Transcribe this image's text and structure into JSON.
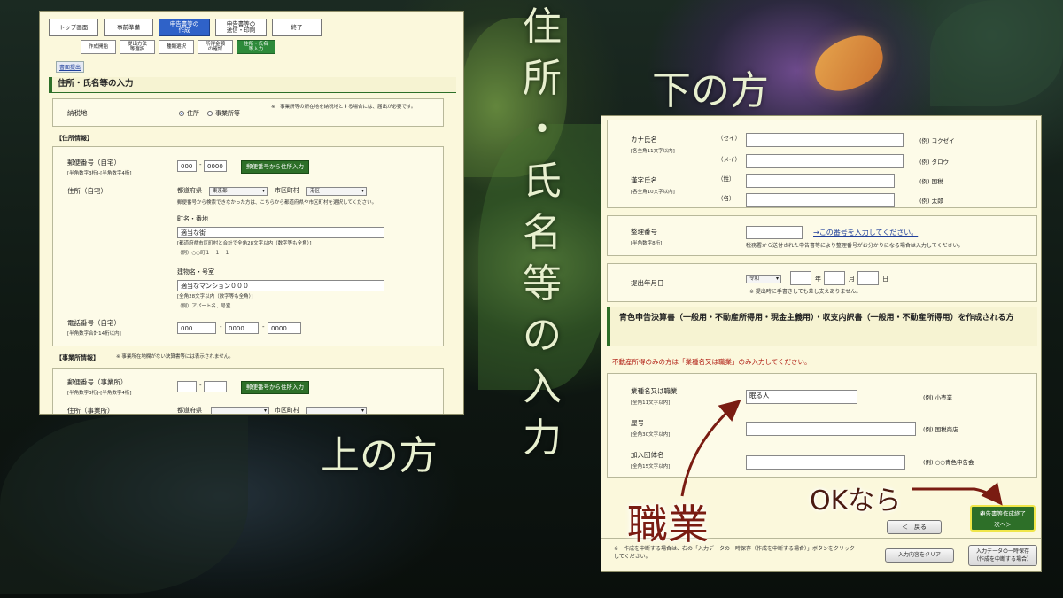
{
  "overlay": {
    "vertical_title": [
      "住",
      "所",
      "・",
      "氏",
      "名",
      "等",
      "の",
      "入",
      "力"
    ],
    "label_bottom": "下の方",
    "label_top": "上の方",
    "label_job": "職業",
    "label_ok": "OKなら",
    "colors": {
      "overlay_text": "#e8f0cf",
      "arrow": "#7a1c12",
      "panel_bg": "#fbf8dc",
      "accent_green": "#2d6f28",
      "step_active": "#2f62c8"
    }
  },
  "left_panel": {
    "steps": [
      "トップ画面",
      "事前準備",
      "申告書等の\n作成",
      "申告書等の\n送信・印刷",
      "終了"
    ],
    "substeps": [
      "作成開始",
      "提出方法\n等選択",
      "種類選択",
      "所得金額\nの確認",
      "住所・氏名\n等入力"
    ],
    "submit_link": "書面提出",
    "section_title": "住所・氏名等の入力",
    "tax_place": {
      "label": "納税地",
      "opt_home": "住所",
      "opt_office": "事業所等",
      "note": "※　事業所等の所在地を納税地とする場合には、届出が必要です。"
    },
    "address_header": "【住所情報】",
    "postal_home": {
      "label": "郵便番号（自宅）",
      "sub": "[半角数字3桁]-[半角数字4桁]",
      "v1": "000",
      "v2": "0000",
      "button": "郵便番号から住所入力"
    },
    "address_home": {
      "label": "住所（自宅）",
      "pref_label": "都道府県",
      "pref_value": "東京都",
      "city_label": "市区町村",
      "city_value": "港区",
      "note": "郵便番号から検索できなかった方は、こちらから都道府県や市区町村を選択してください。"
    },
    "street": {
      "label": "町名・番地",
      "value": "適当な街",
      "note1": "[都道府県市区町村と合計で全角28文字以内（数字等も全角）]",
      "note2": "（例）○○町１－１－１"
    },
    "building": {
      "label": "建物名・号室",
      "value": "適当なマンション０００",
      "note1": "[全角28文字以内（数字等も全角）]",
      "note2": "（例）アパート名、号室"
    },
    "phone": {
      "label": "電話番号（自宅）",
      "sub": "[半角数字合計14桁以内]",
      "v1": "000",
      "v2": "0000",
      "v3": "0000"
    },
    "office_header": "【事業所情報】",
    "office_note": "※ 事業所在地欄がない決算書等には表示されません。",
    "postal_office": {
      "label": "郵便番号（事業所）",
      "sub": "[半角数字3桁]-[半角数字4桁]",
      "button": "郵便番号から住所入力"
    },
    "address_office": {
      "label": "住所（事業所）",
      "pref_label": "都道府県",
      "city_label": "市区町村"
    }
  },
  "right_panel": {
    "kana": {
      "label": "カナ氏名",
      "sub": "[各全角11文字以内]",
      "sei": "（セイ）",
      "mei": "（メイ）",
      "ex1": "(例) コクゼイ",
      "ex2": "(例) タロウ"
    },
    "kanji": {
      "label": "漢字氏名",
      "sub": "[各全角10文字以内]",
      "sei": "（姓）",
      "mei": "（名）",
      "ex1": "(例) 国税",
      "ex2": "(例) 太郎"
    },
    "seiri": {
      "label": "整理番号",
      "sub": "[半角数字8桁]",
      "link": "→この番号を入力してください。",
      "note": "税務署から送付された申告書等により整理番号がお分かりになる場合は入力してください。"
    },
    "date": {
      "label": "提出年月日",
      "era": "令和",
      "year": "年",
      "month": "月",
      "day": "日",
      "note": "※ 提出時に手書きしても差し支えありません。"
    },
    "blue_title": "青色申告決算書（一般用・不動産所得用・現金主義用）・収支内訳書（一般用・不動産所得用）を作成される方",
    "red_note": "不動産所得のみの方は「業種名又は職業」のみ入力してください。",
    "job": {
      "label": "業種名又は職業",
      "sub": "[全角11文字以内]",
      "value": "眠る人",
      "ex": "(例) 小売業"
    },
    "yago": {
      "label": "屋号",
      "sub": "[全角30文字以内]",
      "ex": "(例) 国税商店"
    },
    "org": {
      "label": "加入団体名",
      "sub": "[全角15文字以内]",
      "ex": "(例) ○○青色申告会"
    },
    "back_button": "＜　戻る",
    "finish_line1": "申告書等作成終了",
    "finish_line2": "次へ＞",
    "footer_note": "※　作成を中断する場合は、右の「入力データの一時保存（作成を中断する場合）」ボタンをクリックしてください。",
    "clear_button": "入力内容をクリア",
    "save_line1": "入力データの一時保存",
    "save_line2": "（作成を中断する場合）"
  }
}
